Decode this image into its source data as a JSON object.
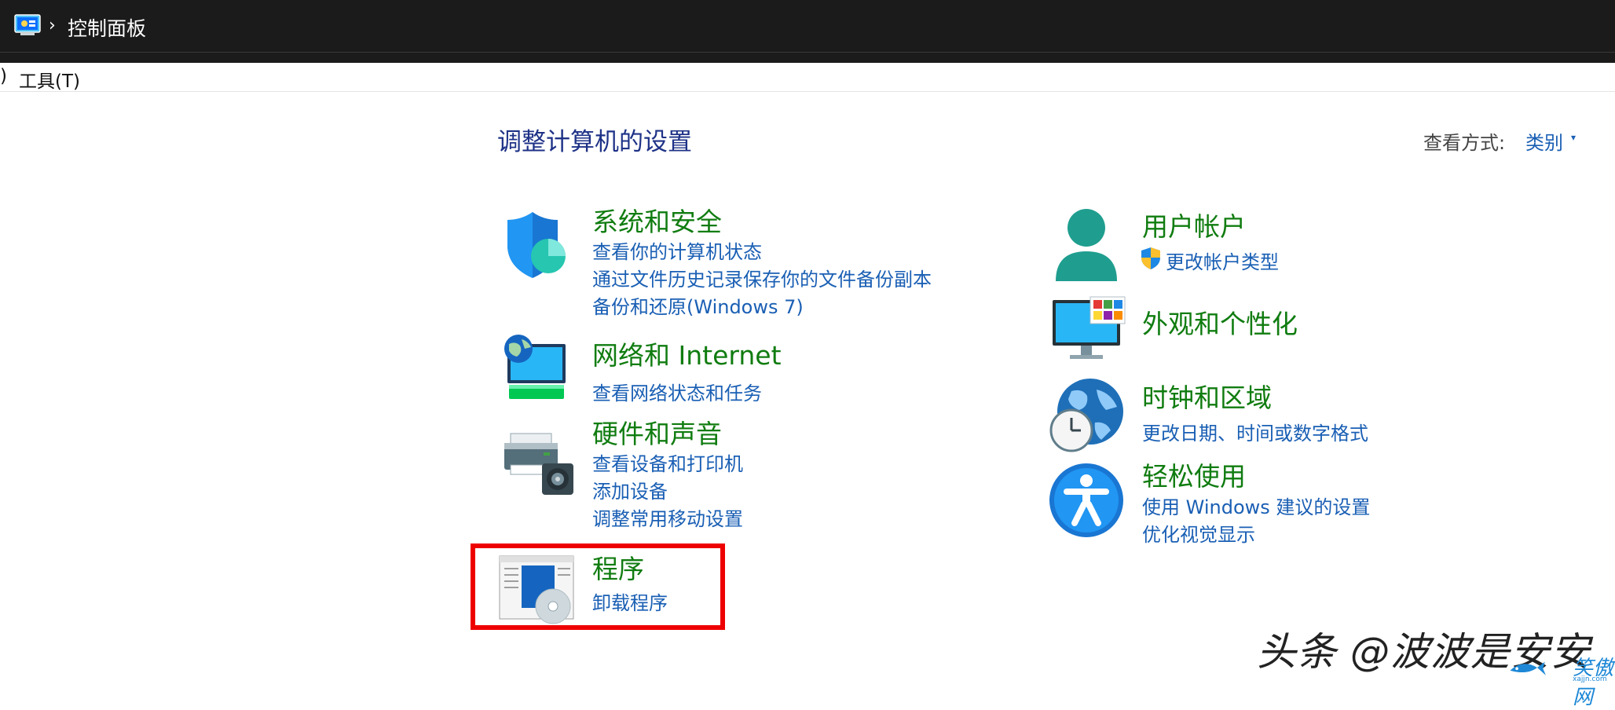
{
  "titlebar": {
    "icon": "control-panel-icon",
    "separator": "›",
    "breadcrumb": "控制面板"
  },
  "menubar": {
    "partial": ")",
    "tools": "工具(T)"
  },
  "header": {
    "title": "调整计算机的设置",
    "view_label": "查看方式:",
    "view_value": "类别",
    "view_arrow": "▾"
  },
  "categories": {
    "system_security": {
      "icon": "shield-icon",
      "title": "系统和安全",
      "links": [
        "查看你的计算机状态",
        "通过文件历史记录保存你的文件备份副本",
        "备份和还原(Windows 7)"
      ]
    },
    "network": {
      "icon": "network-globe-icon",
      "title": "网络和 Internet",
      "links": [
        "查看网络状态和任务"
      ]
    },
    "hardware": {
      "icon": "printer-speaker-icon",
      "title": "硬件和声音",
      "links": [
        "查看设备和打印机",
        "添加设备",
        "调整常用移动设置"
      ]
    },
    "programs": {
      "icon": "programs-disc-icon",
      "title": "程序",
      "links": [
        "卸载程序"
      ]
    },
    "user_accounts": {
      "icon": "user-icon",
      "title": "用户帐户",
      "links": [
        "更改帐户类型"
      ],
      "link_icon": "uac-shield-icon"
    },
    "appearance": {
      "icon": "monitor-colors-icon",
      "title": "外观和个性化",
      "links": []
    },
    "clock_region": {
      "icon": "clock-globe-icon",
      "title": "时钟和区域",
      "links": [
        "更改日期、时间或数字格式"
      ]
    },
    "ease_of_access": {
      "icon": "accessibility-icon",
      "title": "轻松使用",
      "links": [
        "使用 Windows 建议的设置",
        "优化视觉显示"
      ]
    }
  },
  "annotation": {
    "highlight_color": "#ee0000"
  },
  "watermark": {
    "text": "头条 @波波是安安",
    "logo_text": "笑傲网",
    "logo_sub": "xajjn.com"
  },
  "colors": {
    "titlebar_bg": "#1b1b1b",
    "category_title": "#107c10",
    "link": "#1a5fb4",
    "page_title": "#1e3287"
  }
}
